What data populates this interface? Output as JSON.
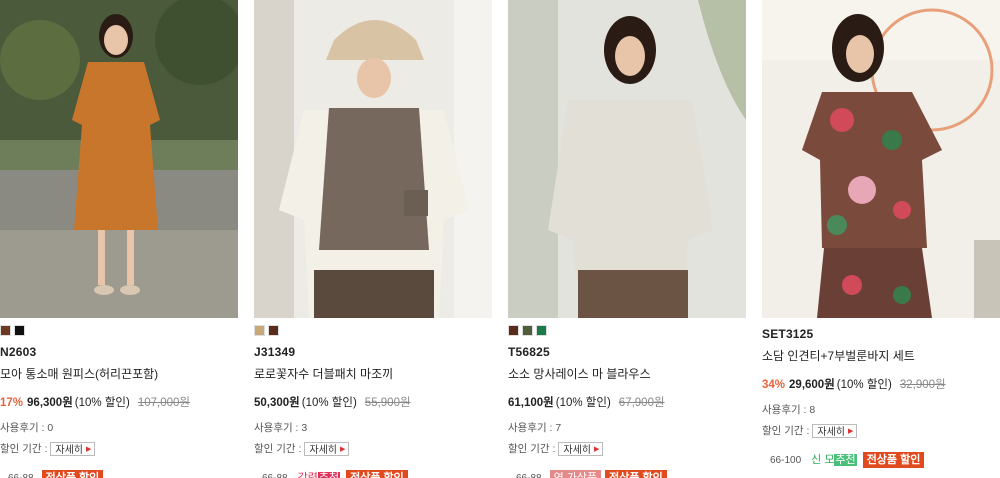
{
  "products": [
    {
      "code": "N2603",
      "name": "모아 통소매 원피스(허리끈포함)",
      "colors": [
        "#6b3a20",
        "#111111"
      ],
      "discount_rate": "17%",
      "sale_price": "96,300원",
      "discount_note": "(10% 할인)",
      "original_price": "107,000원",
      "review_label": "사용후기 : 0",
      "period_label": "할인 기간 :",
      "detail_label": "자세히",
      "size": "66-88",
      "badges": {
        "all_sale": "전상품 할인"
      }
    },
    {
      "code": "J31349",
      "name": "로로꽃자수 더블패치 마조끼",
      "colors": [
        "#c9a877",
        "#5a2a1a"
      ],
      "discount_rate": "",
      "sale_price": "50,300원",
      "discount_note": "(10% 할인)",
      "original_price": "55,900원",
      "review_label": "사용후기 : 3",
      "period_label": "할인 기간 :",
      "detail_label": "자세히",
      "size": "66-88",
      "badges": {
        "strong_a": "강력",
        "strong_b": "추천",
        "all_sale": "전상품 할인"
      }
    },
    {
      "code": "T56825",
      "name": "소소 망사레이스 마 블라우스",
      "colors": [
        "#5a2a1a",
        "#4f5d3a",
        "#1b7a4a"
      ],
      "discount_rate": "",
      "sale_price": "61,100원",
      "discount_note": "(10% 할인)",
      "original_price": "67,900원",
      "review_label": "사용후기 : 7",
      "period_label": "할인 기간 :",
      "detail_label": "자세히",
      "size": "66-88",
      "badges": {
        "age": "연 가상품",
        "all_sale": "전상품 할인"
      }
    },
    {
      "code": "SET3125",
      "name": "소담 인견티+7부벌룬바지 세트",
      "colors": [],
      "discount_rate": "34%",
      "sale_price": "29,600원",
      "discount_note": "(10% 할인)",
      "original_price": "32,900원",
      "review_label": "사용후기 : 8",
      "period_label": "할인 기간 :",
      "detail_label": "자세히",
      "size": "66-100",
      "badges": {
        "new_a": "신 모",
        "new_b": "추천",
        "all_sale": "전상품 할인"
      }
    }
  ],
  "icons": {
    "detail_arrow": "triangle-right-icon"
  }
}
